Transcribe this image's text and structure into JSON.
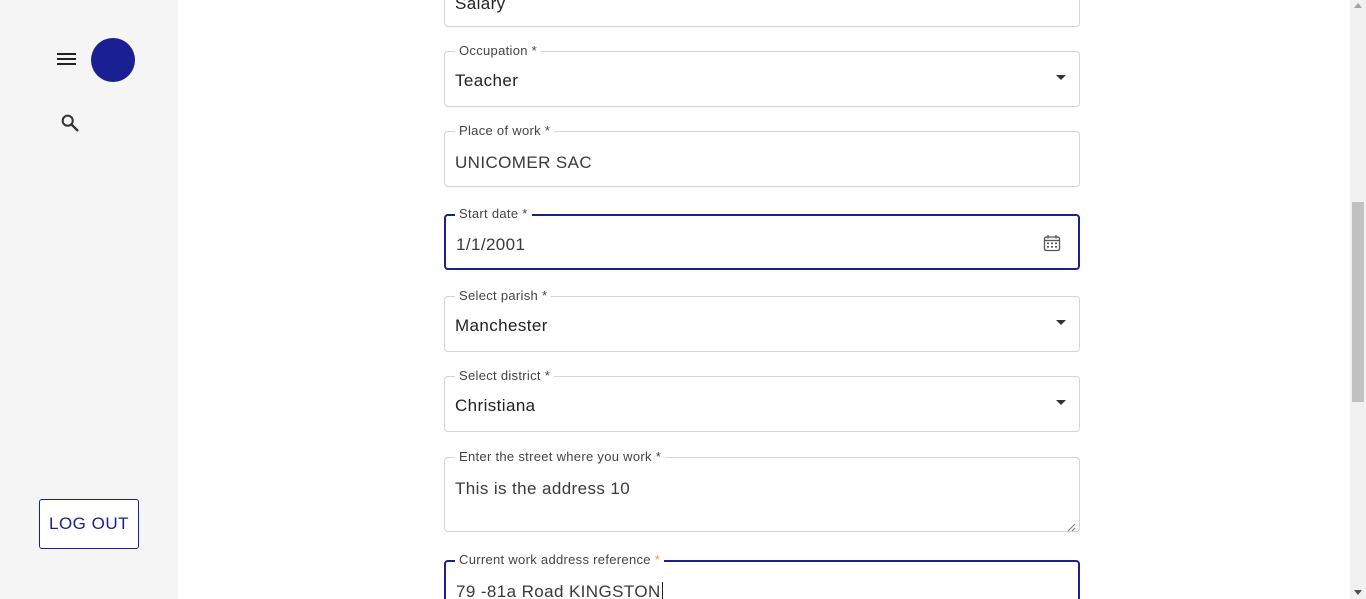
{
  "sidebar": {
    "logout_label": "LOG OUT"
  },
  "form": {
    "income_type": {
      "value": "Salary"
    },
    "occupation": {
      "label": "Occupation *",
      "value": "Teacher"
    },
    "place_of_work": {
      "label": "Place of work *",
      "value": "UNICOMER SAC"
    },
    "start_date": {
      "label": "Start date *",
      "value": "1/1/2001"
    },
    "parish": {
      "label": "Select parish *",
      "value": "Manchester"
    },
    "district": {
      "label": "Select district *",
      "value": "Christiana"
    },
    "street": {
      "label": "Enter the street where you work *",
      "value": "This is the address 10"
    },
    "address_reference": {
      "label": "Current work address reference",
      "required_mark": "*",
      "value": "79 -81a Road KINGSTON"
    }
  },
  "colors": {
    "accent": "#1a1f91",
    "required_accent": "#e6a23c"
  }
}
